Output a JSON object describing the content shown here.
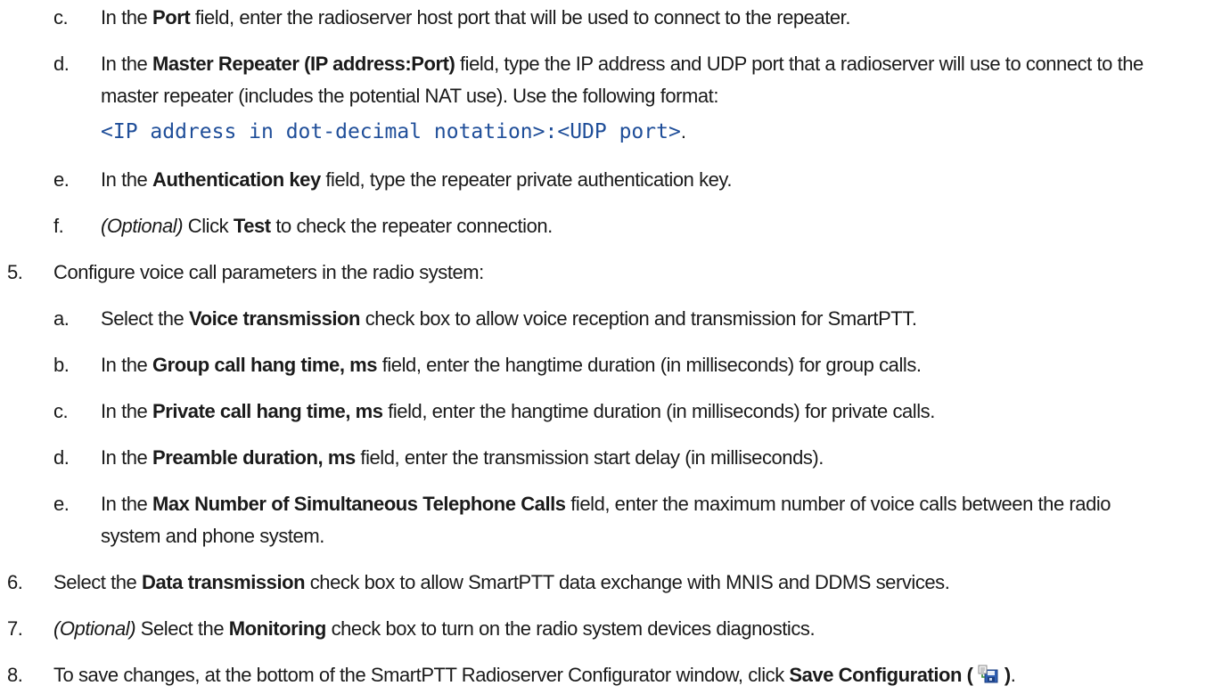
{
  "steps": {
    "s4c": {
      "marker": "c.",
      "t1": "In the ",
      "b1": "Port",
      "t2": " field, enter the radioserver host port that will be used to connect to the repeater."
    },
    "s4d": {
      "marker": "d.",
      "t1": "In the ",
      "b1": "Master Repeater (IP address:Port)",
      "t2": " field, type the IP address and UDP port that a radioserver will use to connect to the",
      "line2": "master repeater (includes the potential NAT use). Use the following format:",
      "code": "<IP address in dot-decimal notation>:<UDP port>",
      "code_end": "."
    },
    "s4e": {
      "marker": "e.",
      "t1": "In the ",
      "b1": "Authentication key",
      "t2": " field, type the repeater private authentication key."
    },
    "s4f": {
      "marker": "f.",
      "i1": "(Optional)",
      "t1": " Click ",
      "b1": "Test",
      "t2": " to check the repeater connection."
    },
    "s5": {
      "marker": "5.",
      "t1": "Configure voice call parameters in the radio system:"
    },
    "s5a": {
      "marker": "a.",
      "t1": "Select the ",
      "b1": "Voice transmission",
      "t2": " check box to allow voice reception and transmission for SmartPTT."
    },
    "s5b": {
      "marker": "b.",
      "t1": "In the ",
      "b1": "Group call hang time, ms",
      "t2": " field, enter the hangtime duration (in milliseconds) for group calls."
    },
    "s5c": {
      "marker": "c.",
      "t1": "In the ",
      "b1": "Private call hang time, ms",
      "t2": " field, enter the hangtime duration (in milliseconds) for private calls."
    },
    "s5d": {
      "marker": "d.",
      "t1": "In the ",
      "b1": "Preamble duration, ms",
      "t2": " field, enter the transmission start delay (in milliseconds)."
    },
    "s5e": {
      "marker": "e.",
      "t1": "In the ",
      "b1": "Max Number of Simultaneous Telephone Calls",
      "t2": " field, enter the maximum number of voice calls between the radio",
      "line2": "system and phone system."
    },
    "s6": {
      "marker": "6.",
      "t1": "Select the ",
      "b1": "Data transmission",
      "t2": " check box to allow SmartPTT data exchange with MNIS and DDMS services."
    },
    "s7": {
      "marker": "7.",
      "i1": "(Optional)",
      "t1": " Select the ",
      "b1": "Monitoring",
      "t2": " check box to turn on the radio system devices diagnostics."
    },
    "s8": {
      "marker": "8.",
      "t1": "To save changes, at the bottom of the SmartPTT Radioserver Configurator window, click ",
      "b1": "Save Configuration (",
      "icon": "save-configuration-icon",
      "b2": ")",
      "t2": "."
    }
  },
  "colors": {
    "text": "#1a1a1a",
    "code": "#1f4e99"
  }
}
